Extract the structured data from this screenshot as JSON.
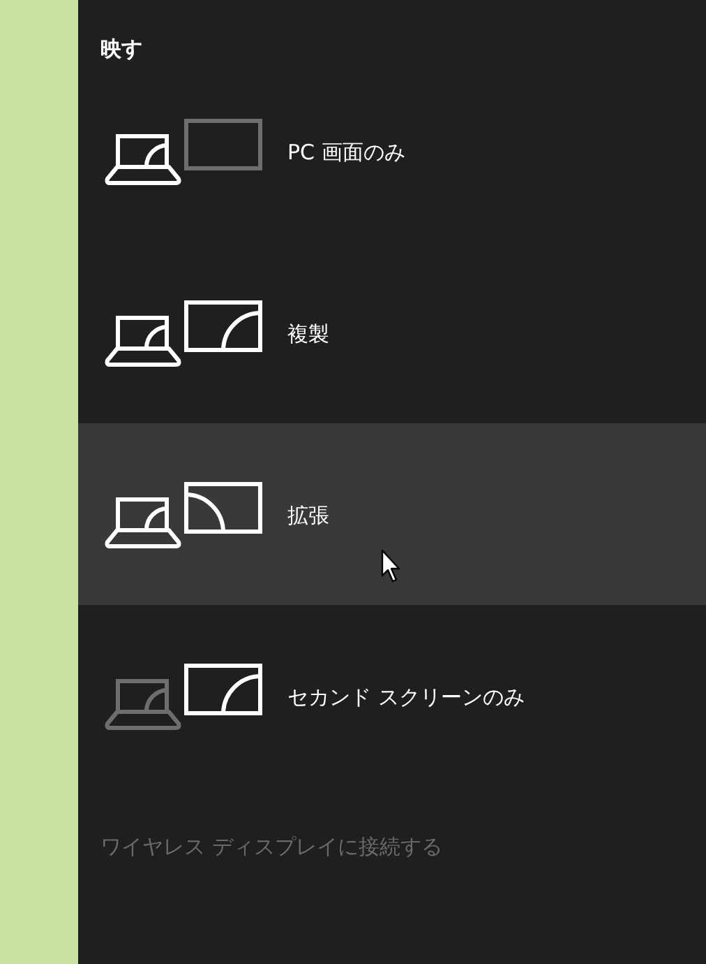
{
  "panel": {
    "title": "映す",
    "options": [
      {
        "kind": "pc_only",
        "label": "PC 画面のみ",
        "selected": false
      },
      {
        "kind": "duplicate",
        "label": "複製",
        "selected": false
      },
      {
        "kind": "extend",
        "label": "拡張",
        "selected": true
      },
      {
        "kind": "second_only",
        "label": "セカンド スクリーンのみ",
        "selected": false
      }
    ],
    "wireless_link": "ワイヤレス ディスプレイに接続する"
  }
}
